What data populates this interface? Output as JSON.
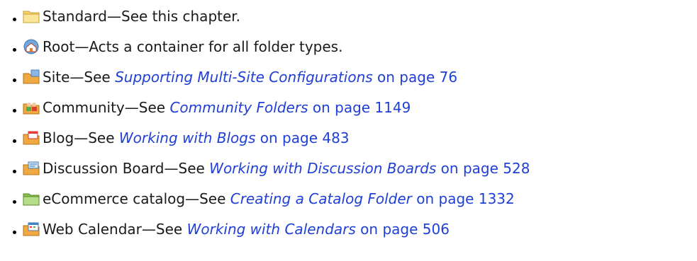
{
  "items": [
    {
      "icon": "standard-folder-icon",
      "label": "Standard",
      "dash": "—",
      "desc": "See this chapter.",
      "link_title": "",
      "link_page": ""
    },
    {
      "icon": "root-folder-icon",
      "label": "Root",
      "dash": "—",
      "desc": "Acts a container for all folder types.",
      "link_title": "",
      "link_page": ""
    },
    {
      "icon": "site-folder-icon",
      "label": "Site",
      "dash": "—",
      "desc": "See ",
      "link_title": "Supporting Multi-Site Configurations",
      "link_page": " on page 76"
    },
    {
      "icon": "community-folder-icon",
      "label": "Community",
      "dash": "—",
      "desc": "See ",
      "link_title": "Community Folders",
      "link_page": " on page 1149"
    },
    {
      "icon": "blog-folder-icon",
      "label": "Blog",
      "dash": "—",
      "desc": "See ",
      "link_title": "Working with Blogs",
      "link_page": " on page 483"
    },
    {
      "icon": "discussion-board-folder-icon",
      "label": "Discussion Board",
      "dash": "—",
      "desc": "See ",
      "link_title": "Working with Discussion Boards",
      "link_page": " on page 528"
    },
    {
      "icon": "ecommerce-catalog-folder-icon",
      "label": "eCommerce catalog",
      "dash": "—",
      "desc": "See ",
      "link_title": "Creating a Catalog Folder",
      "link_page": " on page 1332"
    },
    {
      "icon": "web-calendar-folder-icon",
      "label": "Web Calendar",
      "dash": "—",
      "desc": "See ",
      "link_title": "Working with Calendars",
      "link_page": " on page 506"
    }
  ]
}
